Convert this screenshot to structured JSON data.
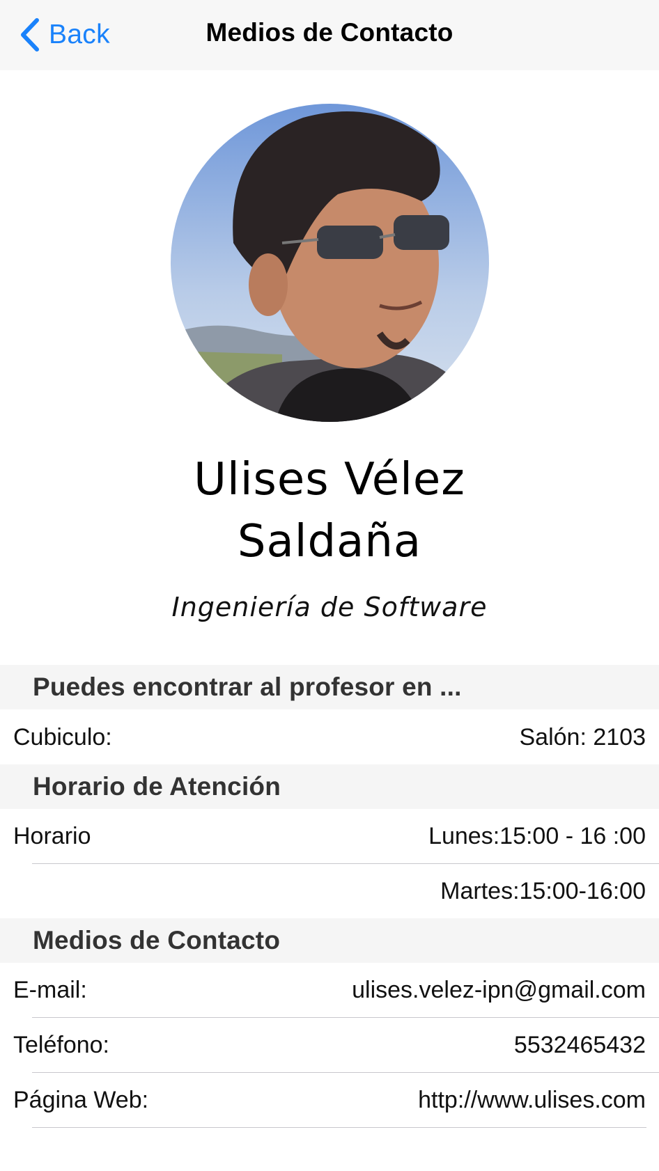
{
  "navbar": {
    "back_label": "Back",
    "title": "Medios de Contacto",
    "accent_color": "#1a82fb"
  },
  "profile": {
    "name_line1": "Ulises Vélez",
    "name_line2": "Saldaña",
    "subtitle": "Ingeniería de Software"
  },
  "sections": {
    "location": {
      "header": "Puedes encontrar al profesor en ...",
      "rows": [
        {
          "label": "Cubiculo:",
          "value": "Salón: 2103"
        }
      ]
    },
    "schedule": {
      "header": "Horario de Atención",
      "rows": [
        {
          "label": "Horario",
          "value": "Lunes:15:00 - 16 :00"
        },
        {
          "label": "",
          "value": "Martes:15:00-16:00"
        }
      ]
    },
    "contact": {
      "header": "Medios de Contacto",
      "rows": [
        {
          "label": "E-mail:",
          "value": "ulises.velez-ipn@gmail.com"
        },
        {
          "label": "Teléfono:",
          "value": "5532465432"
        },
        {
          "label": "Página Web:",
          "value": "http://www.ulises.com"
        }
      ]
    }
  },
  "icons": {
    "back": "chevron-left-icon"
  }
}
